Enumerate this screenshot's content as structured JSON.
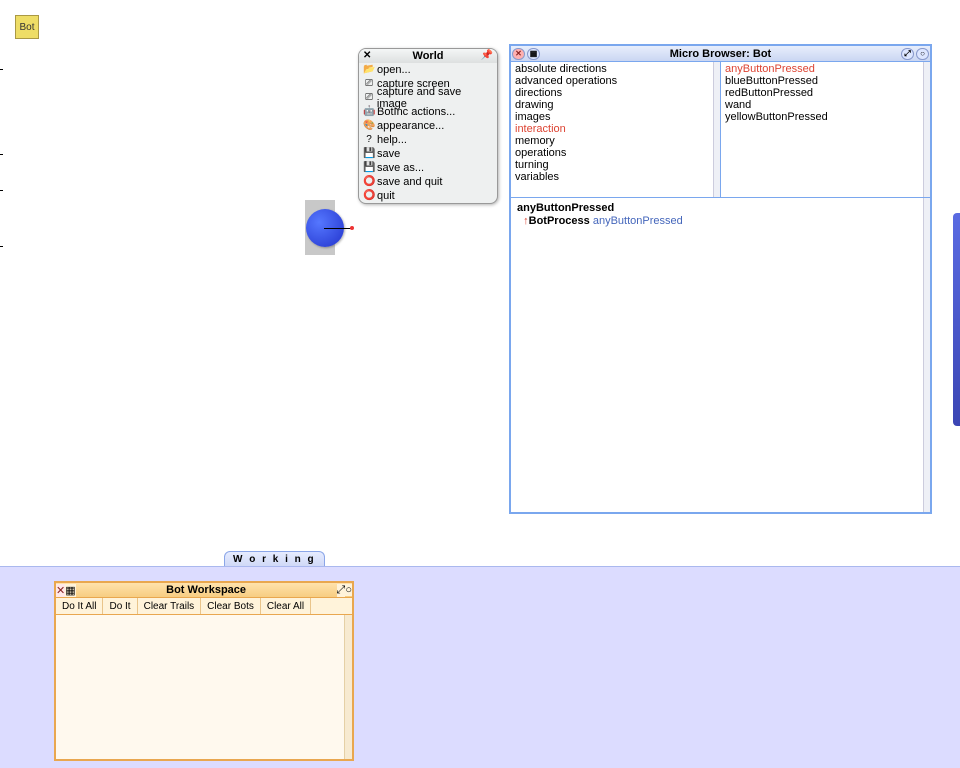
{
  "chip_label": "Bot",
  "world_menu": {
    "title": "World",
    "items": [
      {
        "icon": "📂",
        "label": "open..."
      },
      {
        "icon": "⎚",
        "label": "capture screen"
      },
      {
        "icon": "⎚",
        "label": "capture and save image"
      },
      {
        "icon": "🤖",
        "label": "BotInc actions..."
      },
      {
        "icon": "🎨",
        "label": "appearance..."
      },
      {
        "icon": "?",
        "label": "help..."
      },
      {
        "icon": "💾",
        "label": "save"
      },
      {
        "icon": "💾",
        "label": "save as..."
      },
      {
        "icon": "⭕",
        "label": "save and quit"
      },
      {
        "icon": "⭕",
        "label": "quit"
      }
    ]
  },
  "browser": {
    "title": "Micro Browser: Bot",
    "protocols": [
      "absolute directions",
      "advanced operations",
      "directions",
      "drawing",
      "images",
      "interaction",
      "memory",
      "operations",
      "turning",
      "variables"
    ],
    "protocol_selected": "interaction",
    "methods": [
      "anyButtonPressed",
      "blueButtonPressed",
      "redButtonPressed",
      "wand",
      "yellowButtonPressed"
    ],
    "method_selected": "anyButtonPressed",
    "code_header": "anyButtonPressed",
    "code_class": "BotProcess",
    "code_message": "anyButtonPressed"
  },
  "working_tab": "W o r k i n g",
  "workspace": {
    "title": "Bot Workspace",
    "buttons": [
      "Do It All",
      "Do It",
      "Clear Trails",
      "Clear Bots",
      "Clear All"
    ]
  }
}
